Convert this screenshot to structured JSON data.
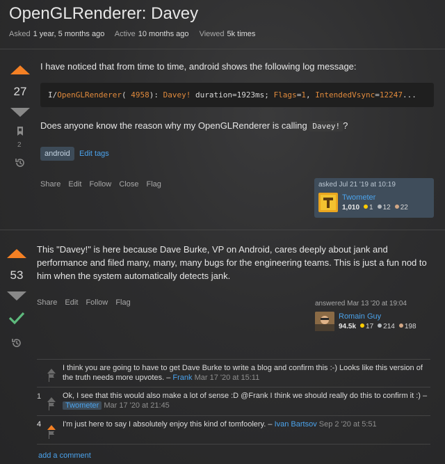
{
  "question": {
    "title": "OpenGLRenderer: Davey",
    "meta": {
      "asked_label": "Asked",
      "asked_value": "1 year, 5 months ago",
      "active_label": "Active",
      "active_value": "10 months ago",
      "viewed_label": "Viewed",
      "viewed_value": "5k times"
    },
    "votes": "27",
    "bookmarks": "2",
    "body_p1": "I have noticed that from time to time, android shows the following log message:",
    "code": {
      "prefix": "I/",
      "tagname": "OpenGLRenderer",
      "paren_open": "(",
      "pid": "4958",
      "paren_close": "): ",
      "davey": "Davey!",
      "duration": " duration=1923ms; ",
      "flags_label": "Flags",
      "flags_eq": "=",
      "flags_val": "1",
      "comma": ", ",
      "vsync_label": "IntendedVsync",
      "vsync_eq": "=",
      "vsync_val": "12247",
      "ellipsis": "..."
    },
    "body_p2_before": "Does anyone know the reason why my OpenGLRenderer is calling ",
    "body_p2_code": "Davey!",
    "body_p2_after": "?",
    "tag": "android",
    "edit_tags": "Edit tags",
    "actions": [
      "Share",
      "Edit",
      "Follow",
      "Close",
      "Flag"
    ],
    "asked_card": {
      "asked": "asked Jul 21 '19 at 10:19",
      "user": "Twometer",
      "rep": "1,010",
      "gold": "1",
      "silver": "12",
      "bronze": "22"
    }
  },
  "answer": {
    "votes": "53",
    "body": "This \"Davey!\" is here because Dave Burke, VP on Android, cares deeply about jank and performance and filed many, many, many bugs for the engineering teams. This is just a fun nod to him when the system automatically detects jank.",
    "actions": [
      "Share",
      "Edit",
      "Follow",
      "Flag"
    ],
    "answered_card": {
      "answered": "answered Mar 13 '20 at 19:04",
      "user": "Romain Guy",
      "rep": "94.5k",
      "gold": "17",
      "silver": "214",
      "bronze": "198"
    }
  },
  "comments": [
    {
      "score": "",
      "text": "I think you are going to have to get Dave Burke to write a blog and confirm this :-) Looks like this version of the truth needs more upvotes. –",
      "user": "Frank",
      "time": "Mar 17 '20 at 15:11"
    },
    {
      "score": "1",
      "text": "Ok, I see that this would also make a lot of sense :D @Frank I think we should really do this to confirm it :) –",
      "user": "Twometer",
      "time": "Mar 17 '20 at 21:45"
    },
    {
      "score": "4",
      "text": "I'm just here to say I absolutely enjoy this kind of tomfoolery. –",
      "user": "Ivan Bartsov",
      "time": "Sep 2 '20 at 5:51"
    }
  ],
  "add_comment": "add a comment",
  "colors": {
    "accent_orange": "#f48024",
    "link_blue": "#4ba3ec",
    "accept_green": "#5eba7d"
  }
}
